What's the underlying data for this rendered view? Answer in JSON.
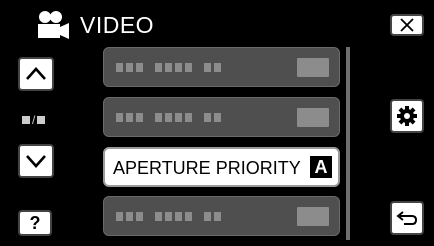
{
  "header": {
    "title": "VIDEO",
    "mode_icon": "video-camera-icon"
  },
  "buttons": {
    "close": "close-icon",
    "up": "up-arrow-icon",
    "down": "down-arrow-icon",
    "help": "?",
    "settings": "gear-icon",
    "back": "return-icon"
  },
  "page_indicator": "/",
  "menu": {
    "items": [
      {
        "label": "",
        "state": "placeholder"
      },
      {
        "label": "",
        "state": "placeholder"
      },
      {
        "label": "APERTURE PRIORITY",
        "mode_letter": "A",
        "state": "selected"
      },
      {
        "label": "",
        "state": "placeholder"
      }
    ]
  },
  "colors": {
    "background": "#000000",
    "item": "#4f4f4f",
    "selected": "#ffffff"
  }
}
